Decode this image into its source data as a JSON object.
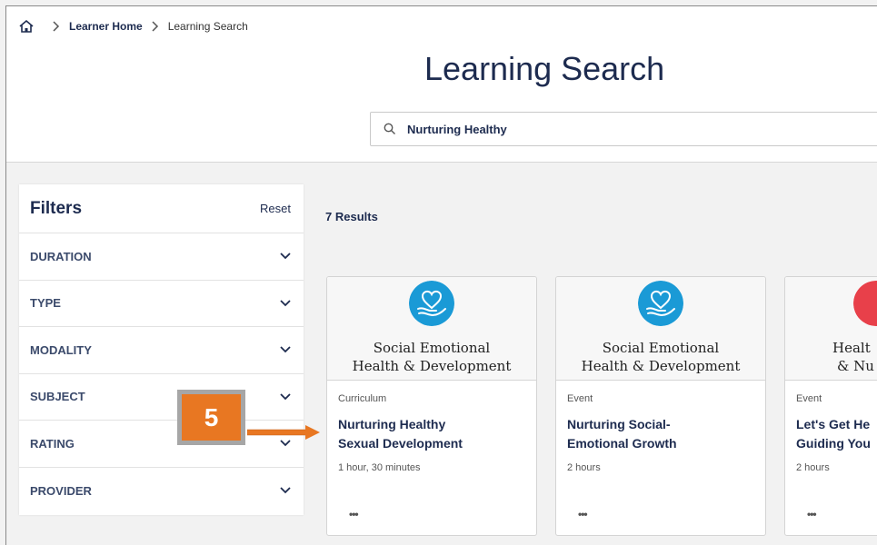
{
  "breadcrumb": {
    "home_icon": "home-icon",
    "items": [
      "Learner Home",
      "Learning Search"
    ]
  },
  "page": {
    "title": "Learning Search"
  },
  "search": {
    "value": "Nurturing Healthy",
    "icon": "search-icon"
  },
  "filters": {
    "title": "Filters",
    "reset_label": "Reset",
    "items": [
      "DURATION",
      "TYPE",
      "MODALITY",
      "SUBJECT",
      "RATING",
      "PROVIDER"
    ]
  },
  "results": {
    "count_label": "7 Results",
    "cards": [
      {
        "banner_line1": "Social Emotional",
        "banner_line2": "Health & Development",
        "type": "Curriculum",
        "title_line1": "Nurturing Healthy",
        "title_line2": "Sexual Development",
        "duration": "1 hour, 30 minutes",
        "more": "•••",
        "logo_color": "#1a9ad6"
      },
      {
        "banner_line1": "Social Emotional",
        "banner_line2": "Health & Development",
        "type": "Event",
        "title_line1": "Nurturing Social-",
        "title_line2": "Emotional Growth",
        "duration": "2 hours",
        "more": "•••",
        "logo_color": "#1a9ad6"
      },
      {
        "banner_line1": "Healt",
        "banner_line2": "& Nu",
        "type": "Event",
        "title_line1": "Let's Get He",
        "title_line2": "Guiding You",
        "duration": "2 hours",
        "more": "•••",
        "logo_color": "#e8404a"
      }
    ]
  },
  "callout": {
    "number": "5",
    "color": "#e87722"
  }
}
